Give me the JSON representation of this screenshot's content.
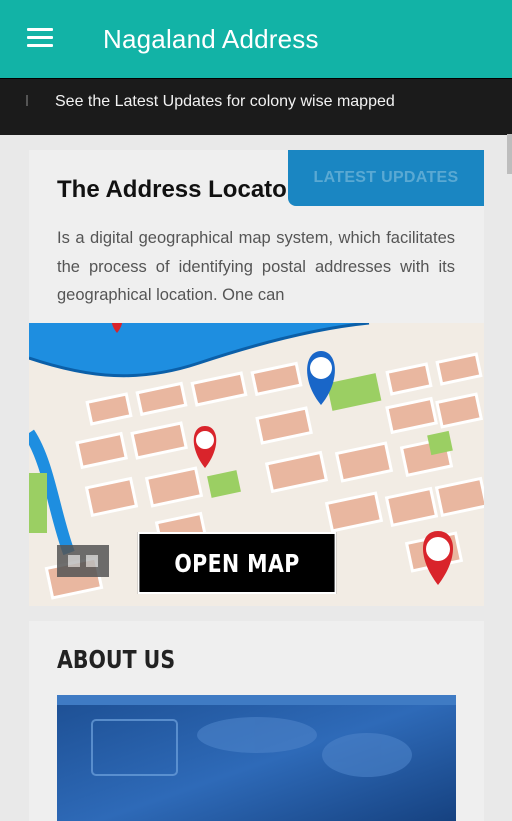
{
  "appbar": {
    "title": "Nagaland Address",
    "menu_icon": "hamburger-menu-icon"
  },
  "ticker": {
    "text": "See the Latest Updates for colony wise mapped"
  },
  "locator": {
    "title": "The Address Locato",
    "updates_label": "LATEST UPDATES",
    "description": "Is a digital geographical map system, which facilitates the process of identifying postal addresses with its geographical location. One can"
  },
  "map": {
    "open_map_label": "OPEN MAP"
  },
  "about": {
    "title": "ABOUT US"
  },
  "colors": {
    "appbar": "#12b3a6",
    "ticker": "#1b1b1b",
    "updates_button": "#1a86c2",
    "card": "#efefef"
  }
}
